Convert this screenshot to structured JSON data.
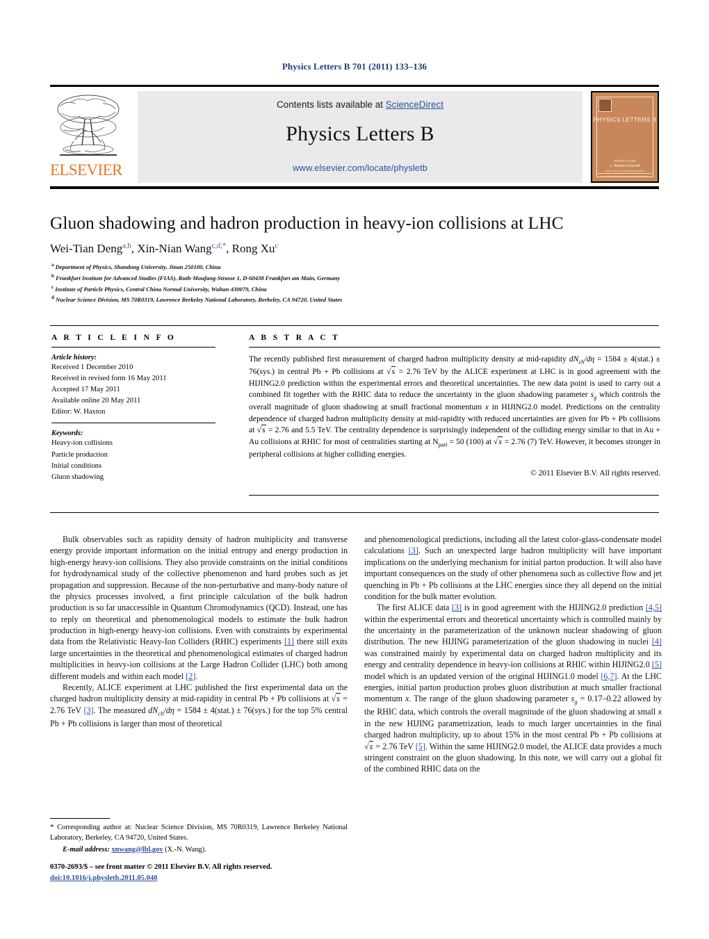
{
  "running_head": "Physics Letters B 701 (2011) 133–136",
  "masthead": {
    "contents_prefix": "Contents lists available at ",
    "sciencedirect": "ScienceDirect",
    "journal_title": "Physics Letters B",
    "journal_url": "www.elsevier.com/locate/physletb",
    "publisher_wordmark": "ELSEVIER",
    "cover": {
      "name": "PHYSICS LETTERS B",
      "sub1": "Editors-in-Chief",
      "sub2": "L. Alvarez-Gaumé",
      "sub3": "www.elsevier.com/locate/physletb",
      "footer": "Available online at www.sciencedirect.com"
    },
    "link_color": "#2a4fa2",
    "panel_bg": "#eaeaea",
    "cover_bg": "#c8875a"
  },
  "article": {
    "title": "Gluon shadowing and hadron production in heavy-ion collisions at LHC",
    "authors": [
      {
        "name": "Wei-Tian Deng",
        "marks": "a,b",
        "sep": ", "
      },
      {
        "name": "Xin-Nian Wang",
        "marks": "c,d,*",
        "sep": ", "
      },
      {
        "name": "Rong Xu",
        "marks": "c",
        "sep": ""
      }
    ],
    "affiliations": [
      {
        "mark": "a",
        "text": "Department of Physics, Shandong University, Jinan 250100, China"
      },
      {
        "mark": "b",
        "text": "Frankfurt Institute for Advanced Studies (FIAS), Ruth-Moufang-Strasse 1, D-60438 Frankfurt am Main, Germany"
      },
      {
        "mark": "c",
        "text": "Institute of Particle Physics, Central China Normal University, Wuhan 430079, China"
      },
      {
        "mark": "d",
        "text": "Nuclear Science Division, MS 70R0319, Lawrence Berkeley National Laboratory, Berkeley, CA 94720, United States"
      }
    ]
  },
  "info": {
    "heading": "A R T I C L E   I N F O",
    "history_label": "Article history:",
    "history": [
      "Received 1 December 2010",
      "Received in revised form 16 May 2011",
      "Accepted 17 May 2011",
      "Available online 20 May 2011",
      "Editor: W. Haxton"
    ],
    "keywords_label": "Keywords:",
    "keywords": [
      "Heavy-ion collisions",
      "Particle production",
      "Initial conditions",
      "Gluon shadowing"
    ]
  },
  "abstract": {
    "heading": "A B S T R A C T",
    "part1": "The recently published first measurement of charged hadron multiplicity density at mid-rapidity ",
    "eq1": "dN",
    "eq1_sub": "ch",
    "eq1_tail": "/dη",
    "part2": " = 1584 ± 4(stat.) ± 76(sys.) in central Pb + Pb collisions at ",
    "sqrt1": "s",
    "part3": " = 2.76 TeV by the ALICE experiment at LHC is in good agreement with the HIJING2.0 prediction within the experimental errors and theoretical uncertainties. The new data point is used to carry out a combined fit together with the RHIC data to reduce the uncertainty in the gluon shadowing parameter ",
    "sg1": "s",
    "sg1_sub": "g",
    "part4": " which controls the overall magnitude of gluon shadowing at small fractional momentum ",
    "x1": "x",
    "part5": " in HIJING2.0 model. Predictions on the centrality dependence of charged hadron multiplicity density at mid-rapidity with reduced uncertainties are given for Pb + Pb collisions at ",
    "sqrt2": "s",
    "part6": " = 2.76 and 5.5 TeV. The centrality dependence is surprisingly independent of the colliding energy similar to that in Au + Au collisions at RHIC for most of centralities starting at ",
    "npart": "N",
    "npart_sub": "part",
    "part7": " = 50 (100) at ",
    "sqrt3": "s",
    "part8": " = 2.76 (7) TeV. However, it becomes stronger in peripheral collisions at higher colliding energies.",
    "copyright": "© 2011 Elsevier B.V. All rights reserved."
  },
  "body": {
    "left": {
      "p1_a": "Bulk observables such as rapidity density of hadron multiplicity and transverse energy provide important information on the initial entropy and energy production in high-energy heavy-ion collisions. They also provide constraints on the initial conditions for hydrodynamical study of the collective phenomenon and hard probes such as jet propagation and suppression. Because of the non-perturbative and many-body nature of the physics processes involved, a first principle calculation of the bulk hadron production is so far unaccessible in Quantum Chromodynamics (QCD). Instead, one has to reply on theoretical and phenomenological models to estimate the bulk hadron production in high-energy heavy-ion collisions. Even with constraints by experimental data from the Relativistic Heavy-Ion Colliders (RHIC) experiments ",
      "p1_ref1": "[1]",
      "p1_b": " there still exits large uncertainties in the theoretical and phenomenological estimates of charged hadron multiplicities in heavy-ion collisions at the Large Hadron Collider (LHC) both among different models and within each model ",
      "p1_ref2": "[2]",
      "p1_c": ".",
      "p2_a": "Recently, ALICE experiment at LHC published the first experimental data on the charged hadron multiplicity density at mid-rapidity in central Pb + Pb collisions at ",
      "p2_sqrt": "s",
      "p2_b": " = 2.76 TeV ",
      "p2_ref": "[3]",
      "p2_c": ". The measured ",
      "p2_eq": "dN",
      "p2_eq_sub": "ch",
      "p2_eq_tail": "/dη",
      "p2_d": " = 1584 ± 4(stat.) ± 76(sys.) for the top 5% central Pb + Pb collisions is larger than most of theoretical"
    },
    "right": {
      "p1_a": "and phenomenological predictions, including all the latest color-glass-condensate model calculations ",
      "p1_ref": "[3]",
      "p1_b": ". Such an unexpected large hadron multiplicity will have important implications on the underlying mechanism for initial parton production. It will also have important consequences on the study of other phenomena such as collective flow and jet quenching in Pb + Pb collisions at the LHC energies since they all depend on the initial condition for the bulk matter evolution.",
      "p2_a": "The first ALICE data ",
      "p2_ref1": "[3]",
      "p2_b": " is in good agreement with the HIJING2.0 prediction ",
      "p2_ref2": "[4,5]",
      "p2_c": " within the experimental errors and theoretical uncertainty which is controlled mainly by the uncertainty in the parameterization of the unknown nuclear shadowing of gluon distribution. The new HIJING parameterization of the gluon shadowing in nuclei ",
      "p2_ref3": "[4]",
      "p2_d": " was constrained mainly by experimental data on charged hadron multiplicity and its energy and centrality dependence in heavy-ion collisions at RHIC within HIJING2.0 ",
      "p2_ref4": "[5]",
      "p2_e": " model which is an updated version of the original HIJING1.0 model ",
      "p2_ref5": "[6,7]",
      "p2_f": ". At the LHC energies, initial parton production probes gluon distribution at much smaller fractional momentum ",
      "p2_x1": "x",
      "p2_g": ". The range of the gluon shadowing parameter ",
      "p2_sg": "s",
      "p2_sg_sub": "g",
      "p2_h": " = 0.17–0.22 allowed by the RHIC data, which controls the overall magnitude of the gluon shadowing at small ",
      "p2_x2": "x",
      "p2_i": " in the new HIJING parametrization, leads to much larger uncertainties in the final charged hadron multiplicity, up to about 15% in the most central Pb + Pb collisions at ",
      "p2_sqrt": "s",
      "p2_j": " = 2.76 TeV ",
      "p2_ref6": "[5]",
      "p2_k": ". Within the same HIJING2.0 model, the ALICE data provides a much stringent constraint on the gluon shadowing. In this note, we will carry out a global fit of the combined RHIC data on the"
    }
  },
  "footnotes": {
    "star": "*",
    "corresponding": " Corresponding author at: Nuclear Science Division, MS 70R0319, Lawrence Berkeley National Laboratory, Berkeley, CA 94720, United States.",
    "email_label": "E-mail address:",
    "email_address": "xnwang@lbl.gov",
    "email_owner": " (X.-N. Wang)."
  },
  "imprint": {
    "line1": "0370-2693/$ – see front matter © 2011 Elsevier B.V. All rights reserved.",
    "doi": "doi:10.1016/j.physletb.2011.05.040"
  }
}
